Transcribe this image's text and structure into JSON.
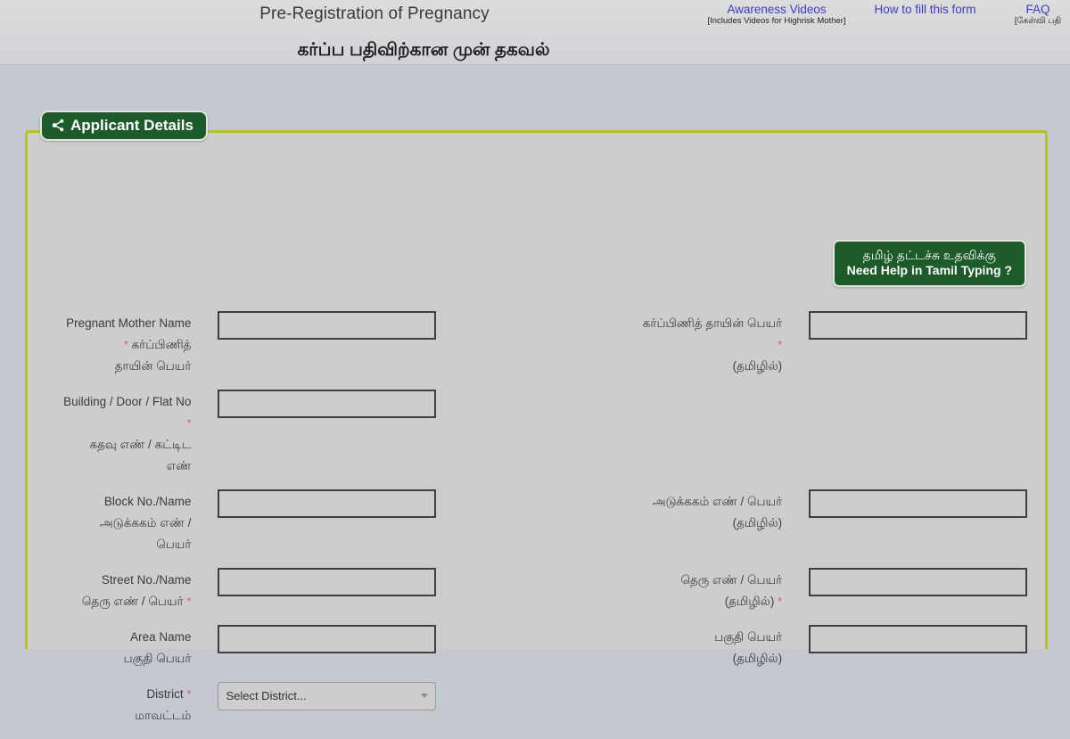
{
  "header": {
    "title_en": "Pre-Registration of Pregnancy",
    "title_ta": "கர்ப்ப பதிவிற்கான முன் தகவல்",
    "links": {
      "awareness": "Awareness Videos",
      "awareness_sub": "[Includes Videos for Highrisk Mother]",
      "howto": "How to fill this form",
      "faq": "FAQ",
      "faq_sub": "[கேள்வி பதி"
    }
  },
  "panel": {
    "legend": "Applicant Details",
    "legend_icon": "share-nodes-icon",
    "tamil_help_ta": "தமிழ் தட்டச்சு உதவிக்கு",
    "tamil_help_en": "Need Help in Tamil Typing ?"
  },
  "colors": {
    "panel_border": "#b5c22e",
    "legend_bg": "#1e5b2a",
    "link": "#3c3cc8",
    "required": "#e05a6e",
    "page_bg": "#c3c8d1",
    "panel_bg": "#cdcdcd"
  },
  "form": {
    "rows": [
      {
        "left_label_en": "Pregnant Mother Name",
        "left_label_ta_1": "கர்ப்பிணித்",
        "left_label_ta_2": "தாயின் பெயர்",
        "left_required": true,
        "left_value": "",
        "right_label_ta_1": "கர்ப்பிணித் தாயின் பெயர்",
        "right_label_ta_2": "(தமிழில்)",
        "right_required": true,
        "right_value": "",
        "has_right": true
      },
      {
        "left_label_en": "Building / Door / Flat No",
        "left_label_ta_1": "கதவு எண் / கட்டிட",
        "left_label_ta_2": "எண்",
        "left_required": true,
        "left_value": "",
        "has_right": false
      },
      {
        "left_label_en": "Block No./Name",
        "left_label_ta_1": "அடுக்ககம் எண் /",
        "left_label_ta_2": "பெயர்",
        "left_required": false,
        "left_value": "",
        "right_label_ta_1": "அடுக்ககம் எண் / பெயர்",
        "right_label_ta_2": "(தமிழில்)",
        "right_required": false,
        "right_value": "",
        "has_right": true
      },
      {
        "left_label_en": "Street No./Name",
        "left_label_ta_1": "தெரு எண் / பெயர்",
        "left_label_ta_2": "",
        "left_required": true,
        "left_value": "",
        "right_label_ta_1": "தெரு எண் / பெயர்",
        "right_label_ta_2": "(தமிழில்)",
        "right_required": true,
        "right_value": "",
        "has_right": true
      },
      {
        "left_label_en": "Area Name",
        "left_label_ta_1": "பகுதி பெயர்",
        "left_label_ta_2": "",
        "left_required": false,
        "left_value": "",
        "right_label_ta_1": "பகுதி பெயர்",
        "right_label_ta_2": "(தமிழில்)",
        "right_required": false,
        "right_value": "",
        "has_right": true
      }
    ],
    "district": {
      "label_en": "District",
      "label_ta": "மாவட்டம்",
      "required": true,
      "selected": "Select District...",
      "options": [
        "Select District..."
      ]
    }
  }
}
